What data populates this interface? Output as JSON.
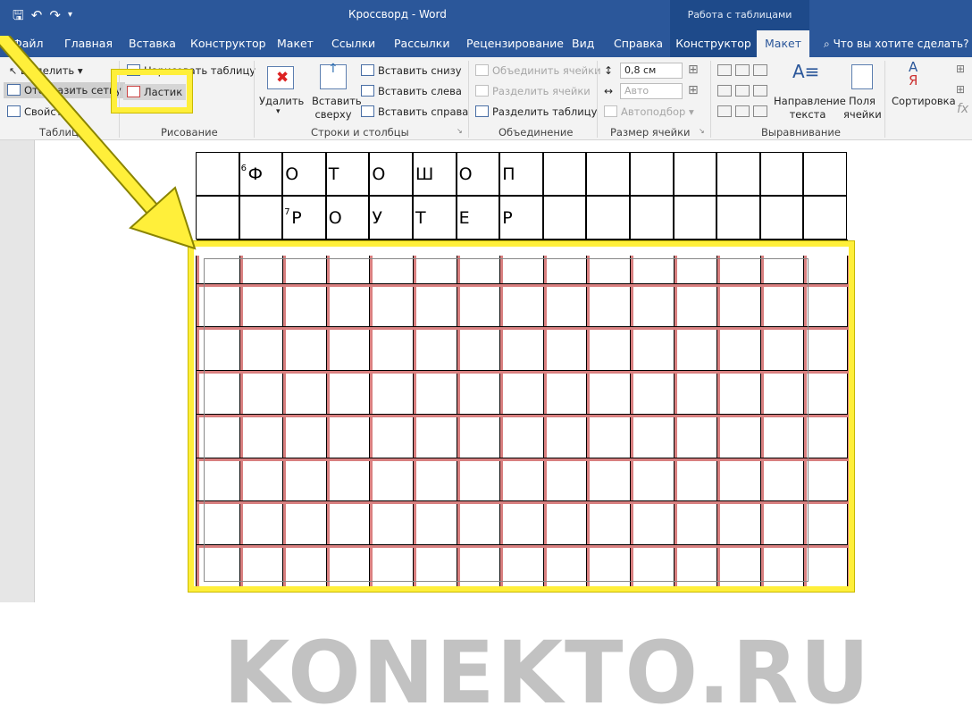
{
  "window": {
    "title": "Кроссворд  -  Word",
    "context_group": "Работа с таблицами"
  },
  "tabs": [
    "Файл",
    "Главная",
    "Вставка",
    "Конструктор",
    "Макет",
    "Ссылки",
    "Рассылки",
    "Рецензирование",
    "Вид",
    "Справка",
    "Конструктор",
    "Макет"
  ],
  "tell_me": "Что вы хотите сделать?",
  "ribbon": {
    "table": {
      "select": "Выделить",
      "show_grid": "Отобразить сетку",
      "properties": "Свойства",
      "label": "Таблица"
    },
    "draw": {
      "draw_table": "Нарисовать таблицу",
      "eraser": "Ластик",
      "label": "Рисование"
    },
    "rows_cols": {
      "delete": "Удалить",
      "insert_above": "Вставить сверху",
      "insert_below": "Вставить снизу",
      "insert_left": "Вставить слева",
      "insert_right": "Вставить справа",
      "label": "Строки и столбцы"
    },
    "merge": {
      "merge_cells": "Объединить ячейки",
      "split_cells": "Разделить ячейки",
      "split_table": "Разделить таблицу",
      "label": "Объединение"
    },
    "cell_size": {
      "height": "0,8 см",
      "width": "Авто",
      "autofit": "Автоподбор",
      "label": "Размер ячейки"
    },
    "align": {
      "direction": "Направление текста",
      "margins": "Поля ячейки",
      "label": "Выравнивание"
    },
    "data": {
      "sort": "Сортировка"
    }
  },
  "crossword": {
    "row1": {
      "number": "6",
      "letters": [
        "Ф",
        "О",
        "Т",
        "О",
        "Ш",
        "О",
        "П"
      ]
    },
    "row2": {
      "number": "7",
      "letters": [
        "Р",
        "О",
        "У",
        "Т",
        "Е",
        "Р"
      ]
    }
  },
  "watermark": "KONEKTO.RU",
  "colors": {
    "accent": "#2b579a",
    "highlight": "#ffef3a",
    "grid_red": "#d98080"
  }
}
